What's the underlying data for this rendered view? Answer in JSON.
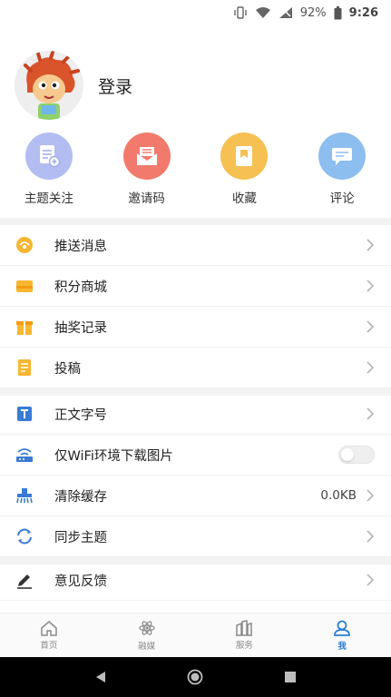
{
  "status_bar": {
    "battery": "92%",
    "time": "9:26",
    "icons": [
      "vibrate-icon",
      "wifi-icon",
      "signal-icon",
      "battery-icon"
    ]
  },
  "profile": {
    "login_label": "登录"
  },
  "quick_actions": [
    {
      "label": "主题关注",
      "icon": "topic-follow-icon",
      "color": "#a8b4f0"
    },
    {
      "label": "邀请码",
      "icon": "invite-code-icon",
      "color": "#f27a6c"
    },
    {
      "label": "收藏",
      "icon": "favorite-icon",
      "color": "#f7c053"
    },
    {
      "label": "评论",
      "icon": "comment-icon",
      "color": "#8dbef0"
    }
  ],
  "menu": {
    "group1": [
      {
        "label": "推送消息",
        "icon": "push-message-icon"
      },
      {
        "label": "积分商城",
        "icon": "points-mall-icon"
      },
      {
        "label": "抽奖记录",
        "icon": "lottery-icon"
      },
      {
        "label": "投稿",
        "icon": "submission-icon"
      }
    ],
    "group2": [
      {
        "label": "正文字号",
        "icon": "font-size-icon"
      },
      {
        "label": "仅WiFi环境下载图片",
        "icon": "wifi-download-icon",
        "toggle": false
      },
      {
        "label": "清除缓存",
        "icon": "clear-cache-icon",
        "value": "0.0KB"
      },
      {
        "label": "同步主题",
        "icon": "sync-icon"
      }
    ],
    "group3": [
      {
        "label": "意见反馈",
        "icon": "feedback-icon"
      }
    ]
  },
  "tabs": [
    {
      "label": "首页",
      "icon": "home-icon"
    },
    {
      "label": "融媒",
      "icon": "atom-icon"
    },
    {
      "label": "服务",
      "icon": "building-icon"
    },
    {
      "label": "我",
      "icon": "user-icon",
      "active": true
    }
  ],
  "colors": {
    "accent": "#2a7fd4",
    "icon_orange": "#f7b733",
    "icon_blue": "#3a7bd5"
  }
}
